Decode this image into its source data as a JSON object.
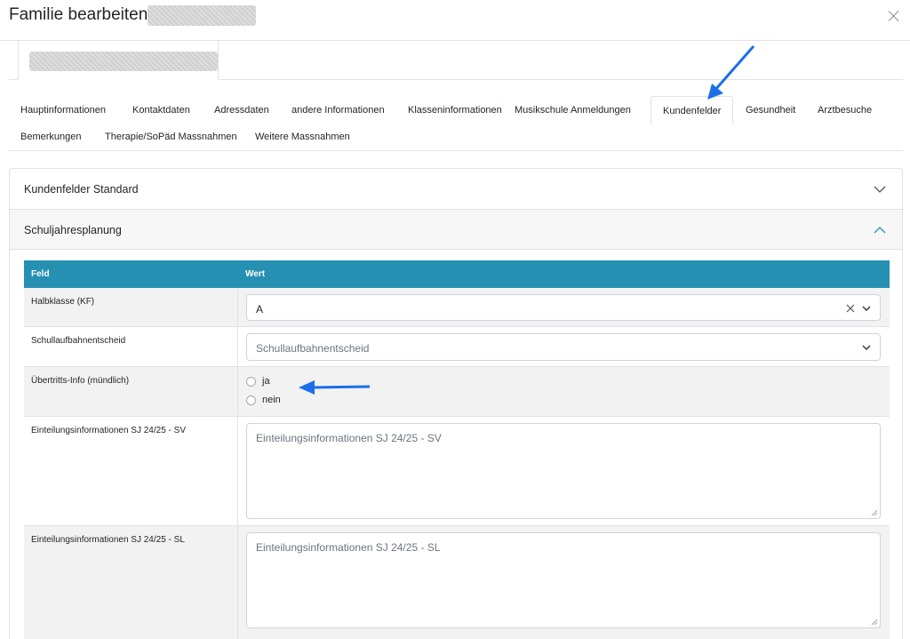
{
  "modal": {
    "title": "Familie bearbeiten"
  },
  "tabs": [
    {
      "label": "Hauptinformationen",
      "active": false
    },
    {
      "label": "Kontaktdaten",
      "active": false
    },
    {
      "label": "Adressdaten",
      "active": false
    },
    {
      "label": "andere Informationen",
      "active": false
    },
    {
      "label": "Klasseninformationen",
      "active": false
    },
    {
      "label": "Musikschule Anmeldungen",
      "active": false
    },
    {
      "label": "Kundenfelder",
      "active": true
    },
    {
      "label": "Gesundheit",
      "active": false
    },
    {
      "label": "Arztbesuche",
      "active": false
    },
    {
      "label": "Bemerkungen",
      "active": false
    },
    {
      "label": "Therapie/SoPäd Massnahmen",
      "active": false
    },
    {
      "label": "Weitere Massnahmen",
      "active": false
    }
  ],
  "accordion": {
    "section1": {
      "label": "Kundenfelder Standard",
      "expanded": false
    },
    "section2": {
      "label": "Schuljahresplanung",
      "expanded": true
    }
  },
  "table": {
    "headers": {
      "feld": "Feld",
      "wert": "Wert"
    },
    "rows": {
      "halbklasse": {
        "label": "Halbklasse (KF)",
        "value": "A"
      },
      "schullaufbahn": {
        "label": "Schullaufbahnentscheid",
        "placeholder": "Schullaufbahnentscheid"
      },
      "uebertritt": {
        "label": "Übertritts-Info (mündlich)",
        "options": [
          "ja",
          "nein"
        ]
      },
      "einteilung_sv": {
        "label": "Einteilungsinformationen SJ 24/25 - SV",
        "placeholder": "Einteilungsinformationen SJ 24/25 - SV"
      },
      "einteilung_sl": {
        "label": "Einteilungsinformationen SJ 24/25 - SL",
        "placeholder": "Einteilungsinformationen SJ 24/25 - SL"
      }
    }
  },
  "colors": {
    "header_bg": "#2690b3",
    "accent_arrow": "#1a6fe8",
    "chevron_open": "#2690b3"
  },
  "icons": {
    "close": "close-icon",
    "chevron_down": "chevron-down-icon",
    "chevron_up": "chevron-up-icon",
    "clear": "clear-icon",
    "resize": "resize-handle-icon"
  }
}
